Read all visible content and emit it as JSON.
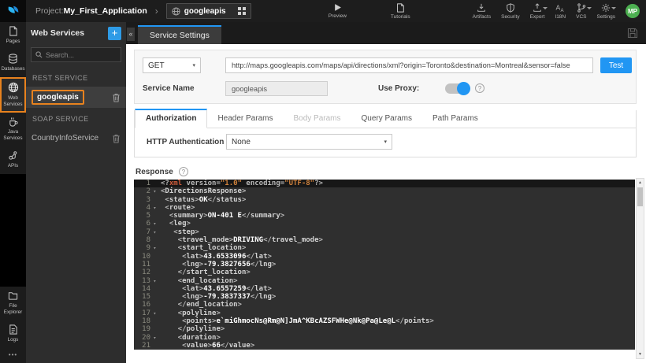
{
  "topbar": {
    "project_label": "Project:",
    "project_name": "My_First_Application",
    "service_selector": {
      "value": "googleapis"
    },
    "preview_label": "Preview",
    "tutorials_label": "Tutorials",
    "actions": [
      {
        "label": "Artifacts"
      },
      {
        "label": "Security"
      },
      {
        "label": "Export",
        "has_caret": true
      },
      {
        "label": "I18N"
      },
      {
        "label": "VCS",
        "has_caret": true
      },
      {
        "label": "Settings",
        "has_caret": true
      }
    ],
    "avatar_initials": "MP"
  },
  "sidebar": {
    "items": [
      {
        "label": "Pages",
        "active": false
      },
      {
        "label": "Databases",
        "active": false
      },
      {
        "label": "Web Services",
        "active": true
      },
      {
        "label": "Java Services",
        "active": false
      },
      {
        "label": "APIs",
        "active": false
      }
    ],
    "bottom_items": [
      {
        "label": "File Explorer"
      },
      {
        "label": "Logs"
      }
    ],
    "more": "•••"
  },
  "services_panel": {
    "title": "Web Services",
    "search_placeholder": "Search...",
    "sections": [
      {
        "header": "REST SERVICE",
        "items": [
          {
            "name": "googleapis",
            "selected": true
          }
        ]
      },
      {
        "header": "SOAP SERVICE",
        "items": [
          {
            "name": "CountryInfoService",
            "selected": false
          }
        ]
      }
    ],
    "collapse_glyph": "«"
  },
  "workspace": {
    "tab_title": "Service Settings",
    "method": "GET",
    "url": "http://maps.googleapis.com/maps/api/directions/xml?origin=Toronto&destination=Montreal&sensor=false",
    "test_label": "Test",
    "service_name_label": "Service Name",
    "service_name_value": "googleapis",
    "use_proxy_label": "Use Proxy:",
    "use_proxy_on": true,
    "param_tabs": [
      {
        "label": "Authorization",
        "state": "active"
      },
      {
        "label": "Header Params",
        "state": "normal"
      },
      {
        "label": "Body Params",
        "state": "disabled"
      },
      {
        "label": "Query Params",
        "state": "normal"
      },
      {
        "label": "Path Params",
        "state": "normal"
      }
    ],
    "http_auth_label": "HTTP Authentication",
    "http_auth_value": "None",
    "response_label": "Response"
  },
  "editor": {
    "lines": [
      {
        "num": 1,
        "active": true,
        "fold": false,
        "text": "<?xml version=\"1.0\" encoding=\"UTF-8\"?>"
      },
      {
        "num": 2,
        "active": false,
        "fold": true,
        "text": "<DirectionsResponse>"
      },
      {
        "num": 3,
        "active": false,
        "fold": false,
        "text": " <status>OK</status>"
      },
      {
        "num": 4,
        "active": false,
        "fold": true,
        "text": " <route>"
      },
      {
        "num": 5,
        "active": false,
        "fold": false,
        "text": "  <summary>ON-401 E</summary>"
      },
      {
        "num": 6,
        "active": false,
        "fold": true,
        "text": "  <leg>"
      },
      {
        "num": 7,
        "active": false,
        "fold": true,
        "text": "   <step>"
      },
      {
        "num": 8,
        "active": false,
        "fold": false,
        "text": "    <travel_mode>DRIVING</travel_mode>"
      },
      {
        "num": 9,
        "active": false,
        "fold": true,
        "text": "    <start_location>"
      },
      {
        "num": 10,
        "active": false,
        "fold": false,
        "text": "     <lat>43.6533096</lat>"
      },
      {
        "num": 11,
        "active": false,
        "fold": false,
        "text": "     <lng>-79.3827656</lng>"
      },
      {
        "num": 12,
        "active": false,
        "fold": false,
        "text": "    </start_location>"
      },
      {
        "num": 13,
        "active": false,
        "fold": true,
        "text": "    <end_location>"
      },
      {
        "num": 14,
        "active": false,
        "fold": false,
        "text": "     <lat>43.6557259</lat>"
      },
      {
        "num": 15,
        "active": false,
        "fold": false,
        "text": "     <lng>-79.3837337</lng>"
      },
      {
        "num": 16,
        "active": false,
        "fold": false,
        "text": "    </end_location>"
      },
      {
        "num": 17,
        "active": false,
        "fold": true,
        "text": "    <polyline>"
      },
      {
        "num": 18,
        "active": false,
        "fold": false,
        "text": "     <points>e`miGhmocNs@Rm@N]JmA^KBcAZSFWHe@Nk@Pa@Le@L</points>"
      },
      {
        "num": 19,
        "active": false,
        "fold": false,
        "text": "    </polyline>"
      },
      {
        "num": 20,
        "active": false,
        "fold": true,
        "text": "    <duration>"
      },
      {
        "num": 21,
        "active": false,
        "fold": false,
        "text": "     <value>66</value>"
      }
    ]
  },
  "colors": {
    "accent_blue": "#2196f3",
    "selection_orange": "#e8821e",
    "avatar_green": "#4caf50",
    "topbar_bg": "#1d1d1d",
    "panel_bg": "#2d2d2d",
    "editor_bg": "#2f2f2f",
    "syntax_tag": "#d2d2d2",
    "syntax_string": "#d0823c",
    "syntax_keyword": "#cf5b3a",
    "syntax_text": "#ffffff"
  },
  "icons": [
    "wavemaker-logo",
    "globe-icon",
    "grid-icon",
    "play-icon",
    "tutorials-icon",
    "artifacts-icon",
    "security-icon",
    "export-icon",
    "i18n-icon",
    "vcs-icon",
    "settings-icon",
    "pages-icon",
    "databases-icon",
    "java-icon",
    "apis-icon",
    "folder-icon",
    "logs-icon",
    "more-icon",
    "search-icon",
    "plus-icon",
    "collapse-icon",
    "trash-icon",
    "save-icon",
    "help-icon",
    "fold-arrow-icon",
    "caret-down-icon"
  ]
}
